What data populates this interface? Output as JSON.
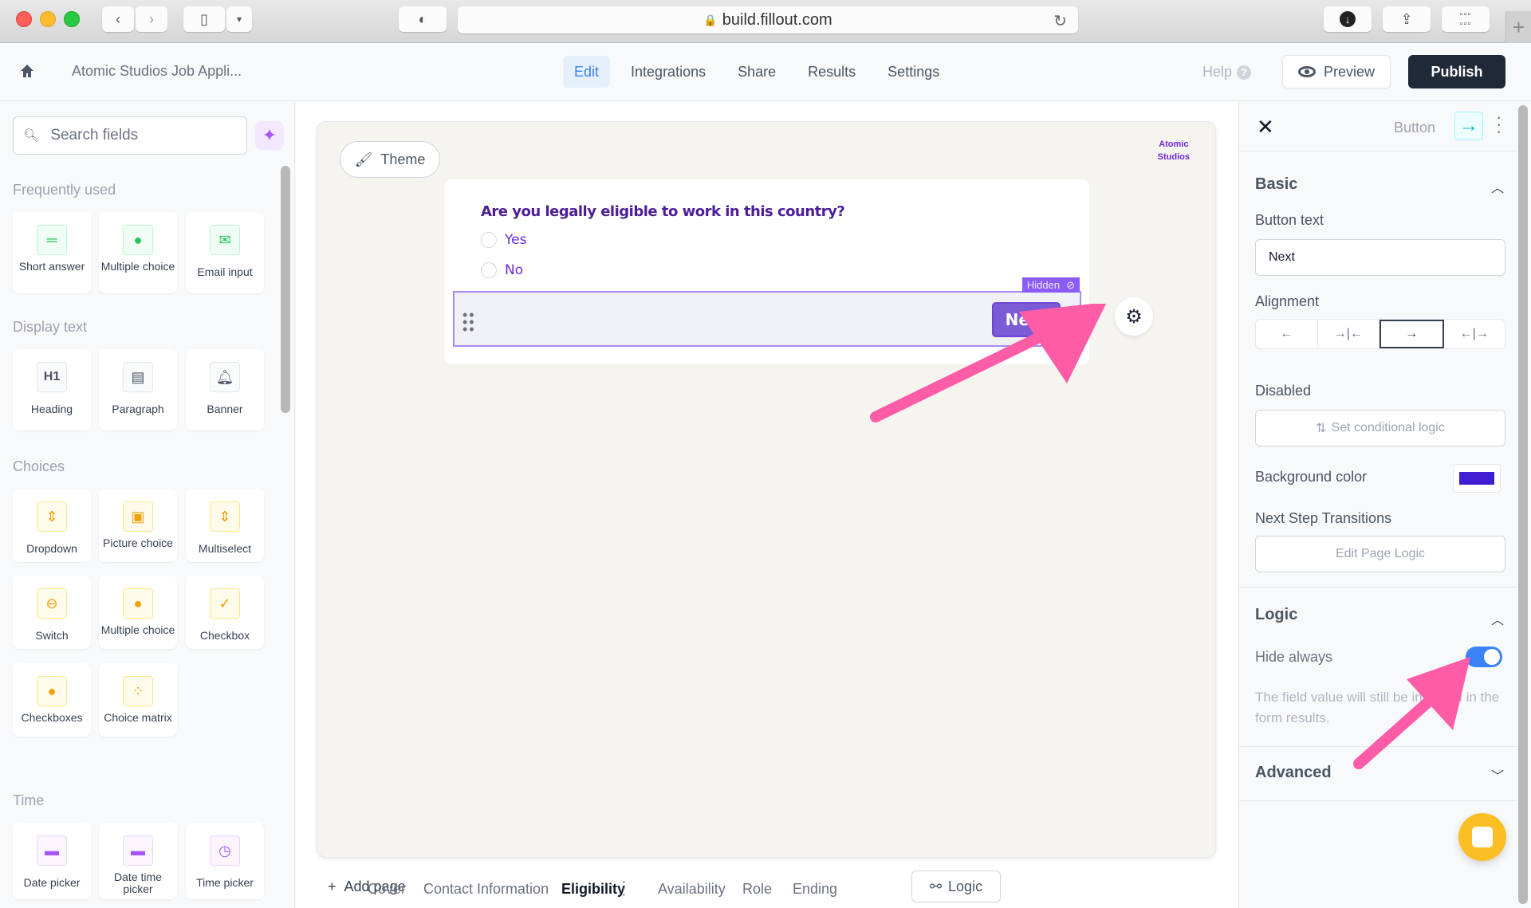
{
  "browser": {
    "url": "build.fillout.com"
  },
  "header": {
    "form_title": "Atomic Studios Job Appli...",
    "nav": [
      {
        "label": "Edit",
        "active": true
      },
      {
        "label": "Integrations"
      },
      {
        "label": "Share"
      },
      {
        "label": "Results"
      },
      {
        "label": "Settings"
      }
    ],
    "help_label": "Help",
    "preview_label": "Preview",
    "publish_label": "Publish"
  },
  "sidebar": {
    "search_placeholder": "Search fields",
    "sections": [
      {
        "title": "Frequently used",
        "items": [
          {
            "label": "Short answer",
            "icon": "short-answer-icon"
          },
          {
            "label": "Multiple choice",
            "icon": "multiple-choice-icon"
          },
          {
            "label": "Email input",
            "icon": "email-icon"
          }
        ]
      },
      {
        "title": "Display text",
        "items": [
          {
            "label": "Heading",
            "icon": "heading-icon"
          },
          {
            "label": "Paragraph",
            "icon": "paragraph-icon"
          },
          {
            "label": "Banner",
            "icon": "bell-icon"
          }
        ]
      },
      {
        "title": "Choices",
        "items": [
          {
            "label": "Dropdown",
            "icon": "dropdown-icon"
          },
          {
            "label": "Picture choice",
            "icon": "picture-icon"
          },
          {
            "label": "Multiselect",
            "icon": "multiselect-icon"
          },
          {
            "label": "Switch",
            "icon": "switch-icon"
          },
          {
            "label": "Multiple choice",
            "icon": "multiple-choice-icon"
          },
          {
            "label": "Checkbox",
            "icon": "checkbox-icon"
          },
          {
            "label": "Checkboxes",
            "icon": "checkboxes-icon"
          },
          {
            "label": "Choice matrix",
            "icon": "matrix-icon"
          }
        ]
      },
      {
        "title": "Time",
        "items": [
          {
            "label": "Date picker",
            "icon": "calendar-icon"
          },
          {
            "label": "Date time picker",
            "icon": "calendar-icon"
          },
          {
            "label": "Time picker",
            "icon": "clock-icon"
          }
        ]
      }
    ]
  },
  "canvas": {
    "theme_label": "Theme",
    "logo_line1": "Atomic",
    "logo_line2": "Studios",
    "question": "Are you legally eligible to work in this country?",
    "options": [
      "Yes",
      "No"
    ],
    "hidden_tag": "Hidden",
    "button_label": "Next"
  },
  "pages": {
    "add_label": "Add page",
    "tabs": [
      {
        "label": "Cover"
      },
      {
        "label": "Contact Information"
      },
      {
        "label": "Eligibility",
        "active": true
      },
      {
        "label": "Availability"
      },
      {
        "label": "Role"
      },
      {
        "label": "Ending"
      }
    ],
    "logic_label": "Logic"
  },
  "panel": {
    "type_label": "Button",
    "basic": {
      "title": "Basic",
      "button_text_label": "Button text",
      "button_text_value": "Next",
      "alignment_label": "Alignment",
      "alignment_options": [
        "←",
        "→|←",
        "→",
        "←|→"
      ],
      "alignment_selected": 2,
      "disabled_label": "Disabled",
      "conditional_logic_label": "Set conditional logic",
      "bg_color_label": "Background color",
      "bg_color": "#3f1ed1",
      "transitions_label": "Next Step Transitions",
      "edit_logic_label": "Edit Page Logic"
    },
    "logic": {
      "title": "Logic",
      "hide_always_label": "Hide always",
      "hide_always": true,
      "help_text": "The field value will still be included in the form results."
    },
    "advanced": {
      "title": "Advanced"
    }
  },
  "colors": {
    "accent": "#3b82f6",
    "form_primary": "#6d28d9",
    "annotation": "#ff5ca8"
  }
}
